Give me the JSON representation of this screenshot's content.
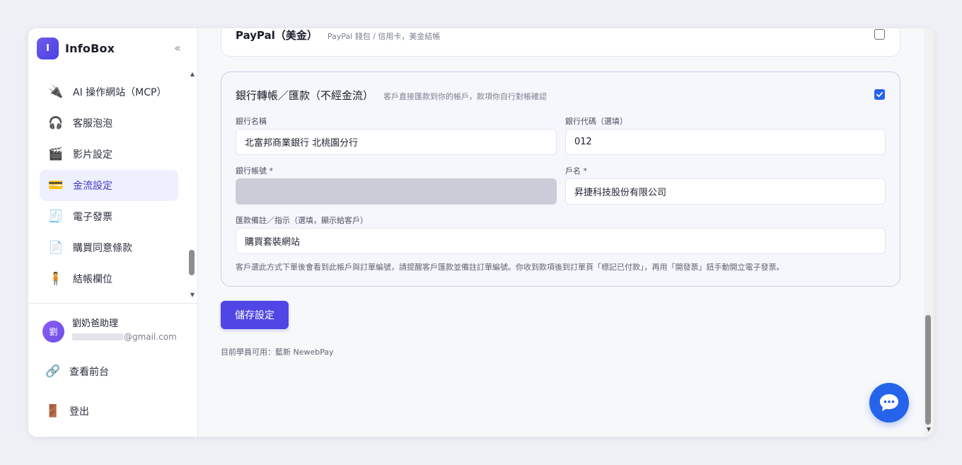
{
  "brand": {
    "logo_letter": "I",
    "name": "InfoBox",
    "collapse_glyph": "«"
  },
  "sidebar": {
    "items": [
      {
        "icon": "🔌",
        "icon_name": "plug-icon",
        "label": "AI 操作網站（MCP）",
        "active": false
      },
      {
        "icon": "🎧",
        "icon_name": "headphones-icon",
        "label": "客服泡泡",
        "active": false
      },
      {
        "icon": "🎬",
        "icon_name": "clapperboard-icon",
        "label": "影片設定",
        "active": false
      },
      {
        "icon": "💳",
        "icon_name": "credit-card-icon",
        "label": "金流設定",
        "active": true
      },
      {
        "icon": "🧾",
        "icon_name": "receipt-icon",
        "label": "電子發票",
        "active": false
      },
      {
        "icon": "📄",
        "icon_name": "document-icon",
        "label": "購買同意條款",
        "active": false
      },
      {
        "icon": "🧍",
        "icon_name": "person-standing-icon",
        "label": "結帳欄位",
        "active": false
      }
    ]
  },
  "user": {
    "avatar_text": "劉",
    "name": "劉奶爸助理",
    "email_domain": "@gmail.com"
  },
  "footer_links": {
    "view_front": {
      "icon": "🔗",
      "label": "查看前台"
    },
    "logout": {
      "icon": "🚪",
      "label": "登出"
    }
  },
  "paypal": {
    "title": "PayPal（美金）",
    "desc": "PayPal 錢包 / 信用卡，美金結帳",
    "checked": false
  },
  "bank": {
    "title": "銀行轉帳／匯款（不經金流）",
    "desc": "客戶直接匯款到你的帳戶，款項你自行對帳確認",
    "checked": true,
    "bank_name_label": "銀行名稱",
    "bank_name_value": "北富邦商業銀行 北桃園分行",
    "bank_code_label": "銀行代碼（選填）",
    "bank_code_value": "012",
    "account_label": "銀行帳號 *",
    "account_value": "",
    "holder_label": "戶名 *",
    "holder_value": "昇捷科技股份有限公司",
    "note_label": "匯款備註／指示（選填，顯示給客戶）",
    "note_value": "購買套裝網站",
    "hint": "客戶選此方式下單後會看到此帳戶與訂單編號，請提醒客戶匯款並備註訂單編號。你收到款項後到訂單頁「標記已付款」，再用「開發票」鈕手動開立電子發票。"
  },
  "save_label": "儲存設定",
  "available_text": "目前學員可用：藍新 NewebPay",
  "colors": {
    "accent": "#4f46e5",
    "checkbox": "#2563eb",
    "chat": "#2563eb"
  }
}
